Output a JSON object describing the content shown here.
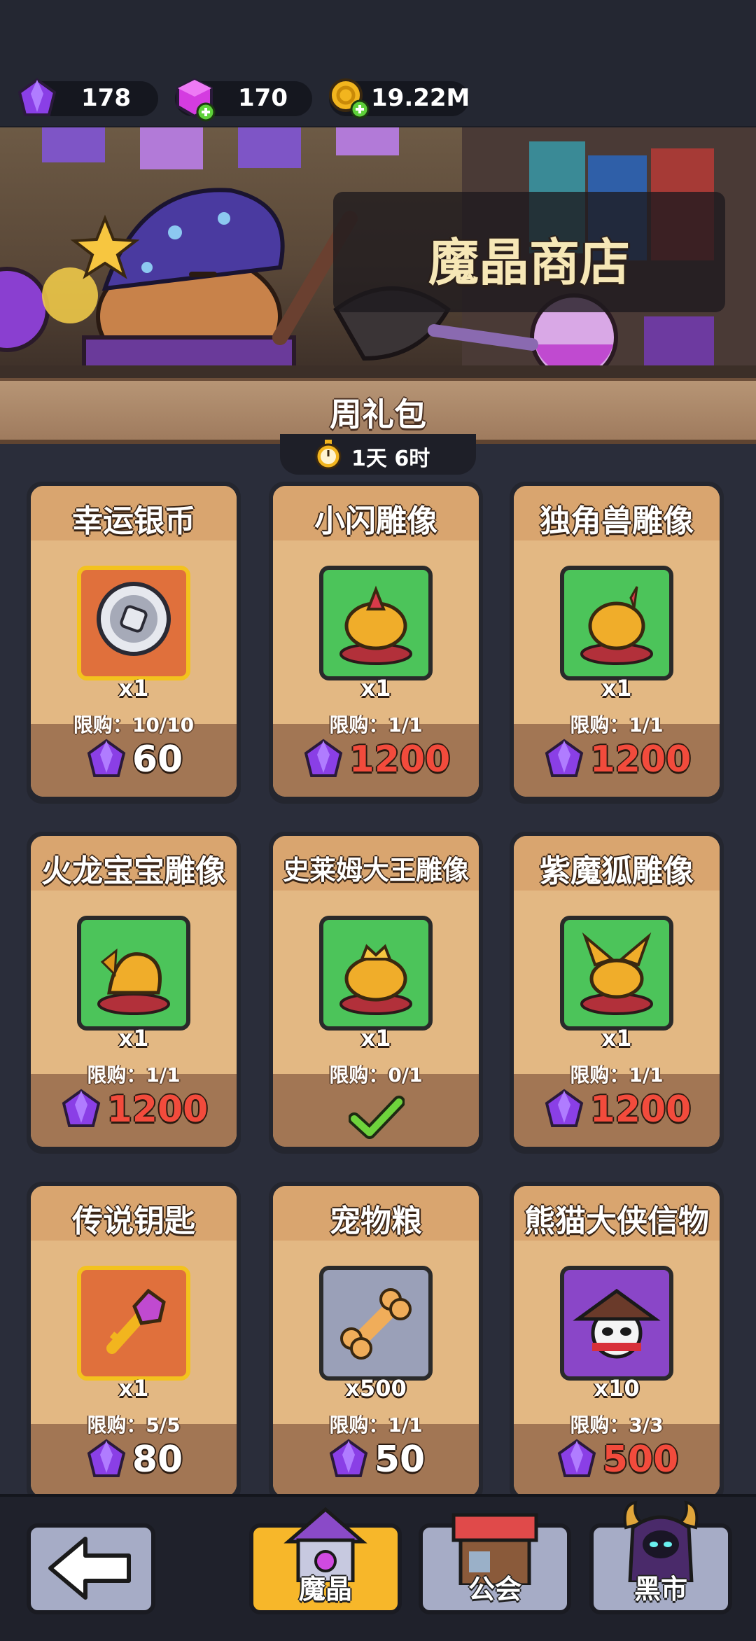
{
  "resources": {
    "gems": "178",
    "crystals": "170",
    "gold": "19.22M"
  },
  "shop": {
    "title": "魔晶商店"
  },
  "section": {
    "title": "周礼包",
    "timer": "1天 6时"
  },
  "items": [
    {
      "name": "幸运银币",
      "icon": "silver-coin-icon",
      "qty": "x1",
      "limit": "限购：10/10",
      "price": "60"
    },
    {
      "name": "小闪雕像",
      "icon": "flash-statue-icon",
      "qty": "x1",
      "limit": "限购：1/1",
      "price": "1200"
    },
    {
      "name": "独角兽雕像",
      "icon": "unicorn-statue-icon",
      "qty": "x1",
      "limit": "限购：1/1",
      "price": "1200"
    },
    {
      "name": "火龙宝宝雕像",
      "icon": "dragon-statue-icon",
      "qty": "x1",
      "limit": "限购：1/1",
      "price": "1200"
    },
    {
      "name": "史莱姆大王雕像",
      "icon": "slime-king-statue-icon",
      "qty": "x1",
      "limit": "限购：0/1",
      "price": ""
    },
    {
      "name": "紫魔狐雕像",
      "icon": "fox-statue-icon",
      "qty": "x1",
      "limit": "限购：1/1",
      "price": "1200"
    },
    {
      "name": "传说钥匙",
      "icon": "key-icon",
      "qty": "x1",
      "limit": "限购：5/5",
      "price": "80"
    },
    {
      "name": "宠物粮",
      "icon": "bone-icon",
      "qty": "x500",
      "limit": "限购：1/1",
      "price": "50"
    },
    {
      "name": "熊猫大侠信物",
      "icon": "panda-hero-icon",
      "qty": "x10",
      "limit": "限购：3/3",
      "price": "500"
    }
  ],
  "nav": {
    "back": "back-arrow-icon",
    "magic": "魔晶",
    "guild": "公会",
    "blackmarket": "黑市"
  },
  "colors": {
    "price_affordable": "#ffffff",
    "price_unaffordable": "#f24b3c",
    "gem_purple": "#7b3fd6"
  }
}
